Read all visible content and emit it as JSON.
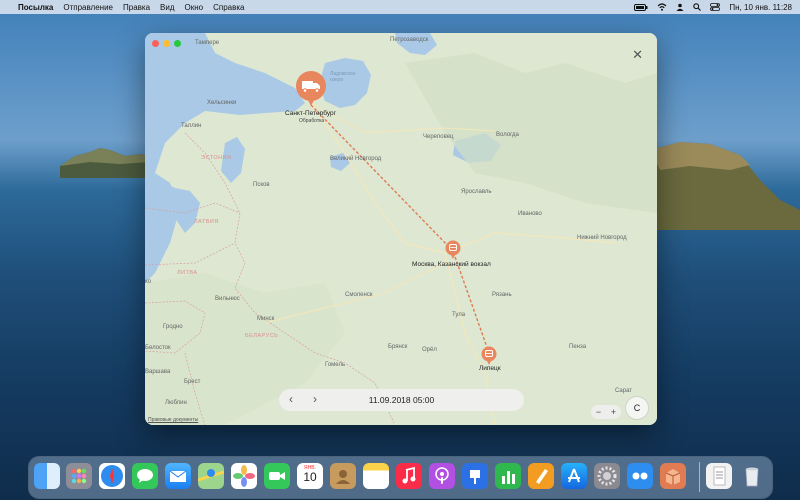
{
  "menubar": {
    "app_name": "Посылка",
    "menus": [
      "Отправление",
      "Правка",
      "Вид",
      "Окно",
      "Справка"
    ],
    "clock": "Пн, 10 янв.  11:28",
    "status_icons": [
      "battery-icon",
      "wifi-icon",
      "user-icon",
      "search-icon",
      "control-center-icon"
    ]
  },
  "map": {
    "labels": {
      "tampere": "Тампере",
      "petrozavodsk": "Петрозаводск",
      "ladoga": "Ладожское озеро",
      "helsinki": "Хельсинки",
      "tallinn": "Таллин",
      "estonia": "ЭСТОНИЯ",
      "cherepovets": "Череповец",
      "vologda": "Вологда",
      "novgorod": "Великий Новгород",
      "pskov": "Псков",
      "yaroslavl": "Ярославль",
      "ivanovo": "Иваново",
      "latvia": "ЛАТВИЯ",
      "n_novgorod": "Нижний Новгород",
      "litva": "ЛИТВА",
      "vilnius": "Вильнюс",
      "smolensk": "Смоленск",
      "ryazan": "Рязань",
      "minsk": "Минск",
      "grodno": "Гродно",
      "tula": "Тула",
      "belarus": "БЕЛАРУСЬ",
      "belostok": "Белосток",
      "bryansk": "Брянск",
      "orel": "Орёл",
      "penza": "Пенза",
      "gomel": "Гомель",
      "varshava": "Варшава",
      "brest": "Брест",
      "lublin": "Люблин",
      "saratov": "Сарат",
      "kaunas": "ко"
    },
    "stops": [
      {
        "name": "Санкт-Петербург",
        "status": "Обработка",
        "icon": "truck-icon"
      },
      {
        "name": "Москва, Казанский вокзал",
        "status": "",
        "icon": "train-icon"
      },
      {
        "name": "Липецк",
        "status": "",
        "icon": "train-icon"
      }
    ],
    "legal_link": "Правовые документы",
    "compass_label": "С",
    "zoom_out": "−",
    "zoom_in": "+"
  },
  "timebar": {
    "datetime": "11.09.2018 05:00",
    "prev": "‹",
    "next": "›"
  },
  "colors": {
    "route": "#e07b52",
    "pin": "#e8865e",
    "land": "#dde7d2",
    "water": "#a9c9e6"
  },
  "dock": {
    "apps": [
      "finder-icon",
      "launchpad-icon",
      "safari-icon",
      "messages-icon",
      "mail-icon",
      "maps-icon",
      "photos-icon",
      "facetime-icon",
      "calendar-icon",
      "contacts-icon",
      "notes-icon",
      "music-icon",
      "podcasts-icon",
      "keynote-icon",
      "numbers-icon",
      "pages-icon",
      "app-store-icon",
      "system-preferences-icon",
      "finder-alt-icon",
      "parcel-icon",
      "document-icon",
      "trash-icon"
    ],
    "calendar_month": "ЯНВ.",
    "calendar_day": "10"
  }
}
